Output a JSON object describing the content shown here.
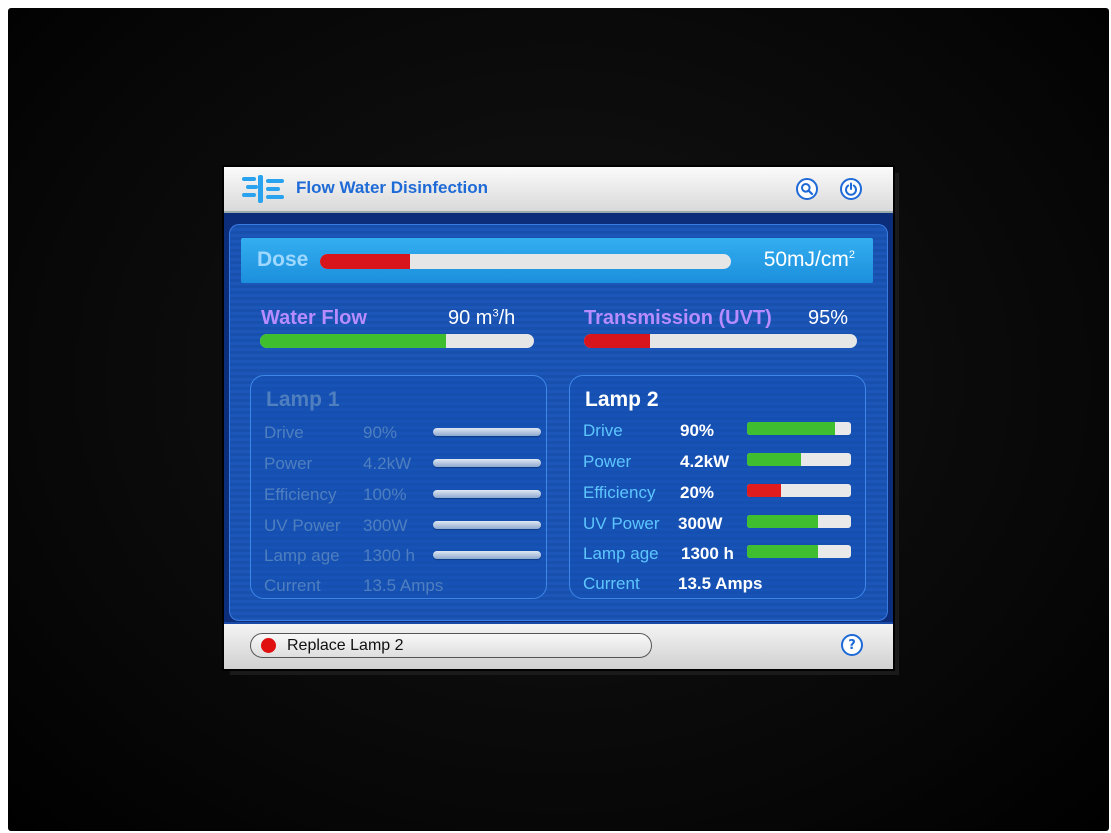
{
  "app": {
    "title": "Flow Water Disinfection"
  },
  "header": {
    "search_icon": "search-icon",
    "power_icon": "power-icon"
  },
  "dose": {
    "label": "Dose",
    "value": "50mJ/cm",
    "unit_sup": "2",
    "level": 0.22
  },
  "water_flow": {
    "label": "Water Flow",
    "value": "90 m",
    "unit_sup": "3",
    "unit_tail": "/h",
    "level": 0.68
  },
  "transmission": {
    "label": "Transmission (UVT)",
    "value": "95%",
    "level": 0.24
  },
  "lamp1": {
    "title": "Lamp 1",
    "rows": [
      {
        "label": "Drive",
        "value": "90%"
      },
      {
        "label": "Power",
        "value": "4.2kW"
      },
      {
        "label": "Efficiency",
        "value": "100%"
      },
      {
        "label": "UV Power",
        "value": "300W"
      },
      {
        "label": "Lamp age",
        "value": "1300 h"
      },
      {
        "label": "Current",
        "value": "13.5 Amps"
      }
    ]
  },
  "lamp2": {
    "title": "Lamp 2",
    "rows": [
      {
        "label": "Drive",
        "value": "90%",
        "level": 0.85,
        "color": "#3fbf2f"
      },
      {
        "label": "Power",
        "value": "4.2kW",
        "level": 0.52,
        "color": "#3fbf2f"
      },
      {
        "label": "Efficiency",
        "value": "20%",
        "level": 0.33,
        "color": "#e01c1c"
      },
      {
        "label": "UV Power",
        "value": "300W",
        "level": 0.68,
        "color": "#3fbf2f"
      },
      {
        "label": "Lamp age",
        "value": "1300 h",
        "level": 0.68,
        "color": "#3fbf2f"
      },
      {
        "label": "Current",
        "value": "13.5 Amps"
      }
    ]
  },
  "status": {
    "alarm_text": "Replace Lamp 2",
    "alarm_color": "#e01010",
    "help_icon": "help-icon"
  },
  "colors": {
    "accent": "#1e6ad6",
    "good": "#3fbf2f",
    "bad": "#e01c1c",
    "label_purple": "#b78cff"
  }
}
